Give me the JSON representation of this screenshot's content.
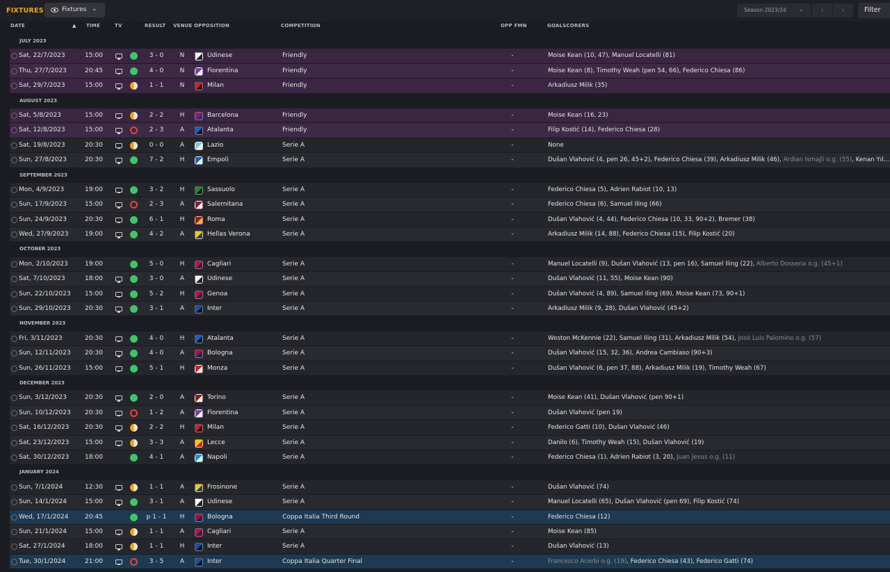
{
  "header": {
    "title": "FIXTURES",
    "view_label": "Fixtures",
    "season_label": "Season 2023/24",
    "filter_label": "Filter"
  },
  "columns": {
    "date": "DATE",
    "time": "TIME",
    "tv": "TV",
    "result": "RESULT",
    "venue": "VENUE",
    "opposition": "OPPOSITION",
    "competition": "COMPETITION",
    "opp_fmn": "OPP FMN",
    "goalscorers": "GOALSCORERS"
  },
  "colors": {
    "accent": "#f3a41b",
    "win": "#3fc56a",
    "draw": "#f0a11b",
    "loss": "#e3473f",
    "friendly_row": "#3a2542",
    "cup_row": "#1e3a52"
  },
  "months": [
    {
      "label": "JULY 2023",
      "matches": [
        {
          "date": "Sat, 22/7/2023",
          "time": "15:00",
          "tv": true,
          "result": "W",
          "score": "3 - 0",
          "venue": "N",
          "opponent": "Udinese",
          "crest": [
            "#ffffff",
            "#222222"
          ],
          "competition": "Friendly",
          "type": "friendly",
          "fmn": "-",
          "scorers": [
            {
              "t": "Moise Kean (10, 47), Manuel Locatelli (81)"
            }
          ]
        },
        {
          "date": "Thu, 27/7/2023",
          "time": "20:45",
          "tv": true,
          "result": "W",
          "score": "4 - 0",
          "venue": "N",
          "opponent": "Fiorentina",
          "crest": [
            "#7b3fb0",
            "#ffffff"
          ],
          "competition": "Friendly",
          "type": "friendly",
          "fmn": "-",
          "scorers": [
            {
              "t": "Moise Kean (8), Timothy Weah (pen 54, 66), Federico Chiesa (86)"
            }
          ]
        },
        {
          "date": "Sat, 29/7/2023",
          "time": "15:00",
          "tv": true,
          "result": "D",
          "score": "1 - 1",
          "venue": "N",
          "opponent": "Milan",
          "crest": [
            "#d0202e",
            "#111111"
          ],
          "competition": "Friendly",
          "type": "friendly",
          "fmn": "-",
          "scorers": [
            {
              "t": "Arkadiusz Milik (35)"
            }
          ]
        }
      ]
    },
    {
      "label": "AUGUST 2023",
      "matches": [
        {
          "date": "Sat, 5/8/2023",
          "time": "15:00",
          "tv": true,
          "result": "D",
          "score": "2 - 2",
          "venue": "H",
          "opponent": "Barcelona",
          "crest": [
            "#a3174c",
            "#0d3b8c"
          ],
          "competition": "Friendly",
          "type": "friendly",
          "fmn": "-",
          "scorers": [
            {
              "t": "Moise Kean (16, 23)"
            }
          ]
        },
        {
          "date": "Sat, 12/8/2023",
          "time": "15:00",
          "tv": true,
          "result": "L",
          "score": "2 - 3",
          "venue": "A",
          "opponent": "Atalanta",
          "crest": [
            "#1d5fb5",
            "#111111"
          ],
          "competition": "Friendly",
          "type": "friendly",
          "fmn": "-",
          "scorers": [
            {
              "t": "Filip Kostić (14), Federico Chiesa (28)"
            }
          ]
        },
        {
          "date": "Sat, 19/8/2023",
          "time": "20:30",
          "tv": true,
          "result": "D",
          "score": "0 - 0",
          "venue": "A",
          "opponent": "Lazio",
          "crest": [
            "#87c2e8",
            "#ffffff"
          ],
          "competition": "Serie A",
          "type": "league",
          "fmn": "-",
          "scorers": [
            {
              "t": "None"
            }
          ]
        },
        {
          "date": "Sun, 27/8/2023",
          "time": "20:30",
          "tv": true,
          "result": "W",
          "score": "7 - 2",
          "venue": "H",
          "opponent": "Empoli",
          "crest": [
            "#1e5dbb",
            "#ffffff"
          ],
          "competition": "Serie A",
          "type": "league",
          "fmn": "-",
          "scorers": [
            {
              "t": "Dušan Vlahović (4, pen 26, 45+2), Federico Chiesa (39), Arkadiusz Milik (46), "
            },
            {
              "t": "Ardian Ismajli o.g. (55)",
              "og": true
            },
            {
              "t": ", Kenan Yıl..."
            }
          ]
        }
      ]
    },
    {
      "label": "SEPTEMBER 2023",
      "matches": [
        {
          "date": "Mon, 4/9/2023",
          "time": "19:00",
          "tv": true,
          "result": "W",
          "score": "3 - 2",
          "venue": "H",
          "opponent": "Sassuolo",
          "crest": [
            "#1f8a3c",
            "#111111"
          ],
          "competition": "Serie A",
          "type": "league",
          "fmn": "-",
          "scorers": [
            {
              "t": "Federico Chiesa (5), Adrien Rabiot (10, 13)"
            }
          ]
        },
        {
          "date": "Sun, 17/9/2023",
          "time": "15:00",
          "tv": true,
          "result": "L",
          "score": "2 - 3",
          "venue": "A",
          "opponent": "Salernitana",
          "crest": [
            "#8c1d2b",
            "#ffffff"
          ],
          "competition": "Serie A",
          "type": "league",
          "fmn": "-",
          "scorers": [
            {
              "t": "Federico Chiesa (6), Samuel Iling (66)"
            }
          ]
        },
        {
          "date": "Sun, 24/9/2023",
          "time": "20:30",
          "tv": true,
          "result": "W",
          "score": "6 - 1",
          "venue": "H",
          "opponent": "Roma",
          "crest": [
            "#8e1f2f",
            "#f0b429"
          ],
          "competition": "Serie A",
          "type": "league",
          "fmn": "-",
          "scorers": [
            {
              "t": "Dušan Vlahović (4, 44), Federico Chiesa (10, 33, 90+2), Bremer (38)"
            }
          ]
        },
        {
          "date": "Wed, 27/9/2023",
          "time": "19:00",
          "tv": true,
          "result": "W",
          "score": "4 - 2",
          "venue": "A",
          "opponent": "Hellas Verona",
          "crest": [
            "#f2c80f",
            "#1b3e8a"
          ],
          "competition": "Serie A",
          "type": "league",
          "fmn": "-",
          "scorers": [
            {
              "t": "Arkadiusz Milik (14, 88), Federico Chiesa (15), Filip Kostić (20)"
            }
          ]
        }
      ]
    },
    {
      "label": "OCTOBER 2023",
      "matches": [
        {
          "date": "Mon, 2/10/2023",
          "time": "19:00",
          "tv": false,
          "result": "W",
          "score": "5 - 0",
          "venue": "H",
          "opponent": "Cagliari",
          "crest": [
            "#c8102e",
            "#0b2a6b"
          ],
          "competition": "Serie A",
          "type": "league",
          "fmn": "-",
          "scorers": [
            {
              "t": "Manuel Locatelli (9), Dušan Vlahović (13, pen 16), Samuel Iling (22), "
            },
            {
              "t": "Alberto Dossena o.g. (45+1)",
              "og": true
            }
          ]
        },
        {
          "date": "Sat, 7/10/2023",
          "time": "18:00",
          "tv": true,
          "result": "W",
          "score": "3 - 0",
          "venue": "A",
          "opponent": "Udinese",
          "crest": [
            "#ffffff",
            "#222222"
          ],
          "competition": "Serie A",
          "type": "league",
          "fmn": "-",
          "scorers": [
            {
              "t": "Dušan Vlahović (11, 55), Moise Kean (90)"
            }
          ]
        },
        {
          "date": "Sun, 22/10/2023",
          "time": "15:00",
          "tv": true,
          "result": "W",
          "score": "5 - 2",
          "venue": "H",
          "opponent": "Genoa",
          "crest": [
            "#c8102e",
            "#0b2a6b"
          ],
          "competition": "Serie A",
          "type": "league",
          "fmn": "-",
          "scorers": [
            {
              "t": "Dušan Vlahović (4, 89), Samuel Iling (69), Moise Kean (73, 90+1)"
            }
          ]
        },
        {
          "date": "Sun, 29/10/2023",
          "time": "20:30",
          "tv": true,
          "result": "W",
          "score": "3 - 1",
          "venue": "A",
          "opponent": "Inter",
          "crest": [
            "#1a4fa0",
            "#111111"
          ],
          "competition": "Serie A",
          "type": "league",
          "fmn": "-",
          "scorers": [
            {
              "t": "Arkadiusz Milik (9, 28), Dušan Vlahović (45+2)"
            }
          ]
        }
      ]
    },
    {
      "label": "NOVEMBER 2023",
      "matches": [
        {
          "date": "Fri, 3/11/2023",
          "time": "20:30",
          "tv": true,
          "result": "W",
          "score": "4 - 0",
          "venue": "H",
          "opponent": "Atalanta",
          "crest": [
            "#1d5fb5",
            "#111111"
          ],
          "competition": "Serie A",
          "type": "league",
          "fmn": "-",
          "scorers": [
            {
              "t": "Weston McKennie (22), Samuel Iling (31), Arkadiusz Milik (54), "
            },
            {
              "t": "José Luis Palomino o.g. (57)",
              "og": true
            }
          ]
        },
        {
          "date": "Sun, 12/11/2023",
          "time": "20:30",
          "tv": true,
          "result": "W",
          "score": "4 - 0",
          "venue": "A",
          "opponent": "Bologna",
          "crest": [
            "#b3102b",
            "#0b2a6b"
          ],
          "competition": "Serie A",
          "type": "league",
          "fmn": "-",
          "scorers": [
            {
              "t": "Dušan Vlahović (15, 32, 36), Andrea Cambiaso (90+3)"
            }
          ]
        },
        {
          "date": "Sun, 26/11/2023",
          "time": "15:00",
          "tv": true,
          "result": "W",
          "score": "5 - 1",
          "venue": "H",
          "opponent": "Monza",
          "crest": [
            "#d0202e",
            "#ffffff"
          ],
          "competition": "Serie A",
          "type": "league",
          "fmn": "-",
          "scorers": [
            {
              "t": "Dušan Vlahović (6, pen 37, 88), Arkadiusz Milik (19), Timothy Weah (67)"
            }
          ]
        }
      ]
    },
    {
      "label": "DECEMBER 2023",
      "matches": [
        {
          "date": "Sun, 3/12/2023",
          "time": "20:30",
          "tv": true,
          "result": "W",
          "score": "2 - 0",
          "venue": "A",
          "opponent": "Torino",
          "crest": [
            "#8b1a1a",
            "#ffffff"
          ],
          "competition": "Serie A",
          "type": "league",
          "fmn": "-",
          "scorers": [
            {
              "t": "Moise Kean (41), Dušan Vlahović (pen 90+1)"
            }
          ]
        },
        {
          "date": "Sun, 10/12/2023",
          "time": "20:30",
          "tv": true,
          "result": "L",
          "score": "1 - 2",
          "venue": "A",
          "opponent": "Fiorentina",
          "crest": [
            "#7b3fb0",
            "#ffffff"
          ],
          "competition": "Serie A",
          "type": "league",
          "fmn": "-",
          "scorers": [
            {
              "t": "Dušan Vlahović (pen 19)"
            }
          ]
        },
        {
          "date": "Sat, 16/12/2023",
          "time": "20:30",
          "tv": true,
          "result": "D",
          "score": "2 - 2",
          "venue": "H",
          "opponent": "Milan",
          "crest": [
            "#d0202e",
            "#111111"
          ],
          "competition": "Serie A",
          "type": "league",
          "fmn": "-",
          "scorers": [
            {
              "t": "Federico Gatti (10), Dušan Vlahović (46)"
            }
          ]
        },
        {
          "date": "Sat, 23/12/2023",
          "time": "15:00",
          "tv": true,
          "result": "D",
          "score": "3 - 3",
          "venue": "A",
          "opponent": "Lecce",
          "crest": [
            "#f2c80f",
            "#d0202e"
          ],
          "competition": "Serie A",
          "type": "league",
          "fmn": "-",
          "scorers": [
            {
              "t": "Danilo (6), Timothy Weah (15), Dušan Vlahović (19)"
            }
          ]
        },
        {
          "date": "Sat, 30/12/2023",
          "time": "18:00",
          "tv": false,
          "result": "W",
          "score": "4 - 1",
          "venue": "A",
          "opponent": "Napoli",
          "crest": [
            "#1f8fd6",
            "#ffffff"
          ],
          "competition": "Serie A",
          "type": "league",
          "fmn": "-",
          "scorers": [
            {
              "t": "Federico Chiesa (1), Adrien Rabiot (3, 20), "
            },
            {
              "t": "Juan Jesus o.g. (11)",
              "og": true
            }
          ]
        }
      ]
    },
    {
      "label": "JANUARY 2024",
      "matches": [
        {
          "date": "Sun, 7/1/2024",
          "time": "12:30",
          "tv": true,
          "result": "D",
          "score": "1 - 1",
          "venue": "A",
          "opponent": "Frosinone",
          "crest": [
            "#f2c80f",
            "#1b3e8a"
          ],
          "competition": "Serie A",
          "type": "league",
          "fmn": "-",
          "scorers": [
            {
              "t": "Dušan Vlahović (74)"
            }
          ]
        },
        {
          "date": "Sun, 14/1/2024",
          "time": "15:00",
          "tv": true,
          "result": "W",
          "score": "3 - 1",
          "venue": "A",
          "opponent": "Udinese",
          "crest": [
            "#ffffff",
            "#222222"
          ],
          "competition": "Serie A",
          "type": "league",
          "fmn": "-",
          "scorers": [
            {
              "t": "Manuel Locatelli (65), Dušan Vlahović (pen 69), Filip Kostić (74)"
            }
          ]
        },
        {
          "date": "Wed, 17/1/2024",
          "time": "20:45",
          "tv": false,
          "result": "W",
          "score": "p 1 - 1",
          "venue": "H",
          "opponent": "Bologna",
          "crest": [
            "#b3102b",
            "#0b2a6b"
          ],
          "competition": "Coppa Italia Third Round",
          "type": "cup",
          "fmn": "-",
          "scorers": [
            {
              "t": "Federico Chiesa (12)"
            }
          ]
        },
        {
          "date": "Sun, 21/1/2024",
          "time": "15:00",
          "tv": true,
          "result": "D",
          "score": "1 - 1",
          "venue": "A",
          "opponent": "Cagliari",
          "crest": [
            "#c8102e",
            "#0b2a6b"
          ],
          "competition": "Serie A",
          "type": "league",
          "fmn": "-",
          "scorers": [
            {
              "t": "Moise Kean (85)"
            }
          ]
        },
        {
          "date": "Sat, 27/1/2024",
          "time": "18:00",
          "tv": true,
          "result": "D",
          "score": "1 - 1",
          "venue": "H",
          "opponent": "Inter",
          "crest": [
            "#1a4fa0",
            "#111111"
          ],
          "competition": "Serie A",
          "type": "league",
          "fmn": "-",
          "scorers": [
            {
              "t": "Dušan Vlahović (13)"
            }
          ]
        },
        {
          "date": "Tue, 30/1/2024",
          "time": "21:00",
          "tv": true,
          "result": "L",
          "score": "3 - 5",
          "venue": "A",
          "opponent": "Inter",
          "crest": [
            "#1a4fa0",
            "#111111"
          ],
          "competition": "Coppa Italia Quarter Final",
          "type": "cup",
          "fmn": "-",
          "scorers": [
            {
              "t": "Francesco Acerbi o.g. (19)",
              "og": true
            },
            {
              "t": ", Federico Chiesa (43), Federico Gatti (74)"
            }
          ]
        }
      ]
    }
  ]
}
